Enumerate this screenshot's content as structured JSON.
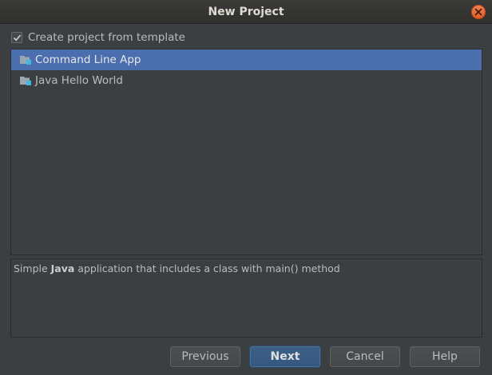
{
  "window": {
    "title": "New Project"
  },
  "template_option": {
    "checked": true,
    "label": "Create project from template"
  },
  "templates": {
    "items": [
      {
        "label": "Command Line App",
        "selected": true
      },
      {
        "label": "Java Hello World",
        "selected": false
      }
    ]
  },
  "description": {
    "prefix": "Simple ",
    "bold": "Java",
    "suffix": " application that includes a class with main() method"
  },
  "buttons": {
    "previous": "Previous",
    "next": "Next",
    "cancel": "Cancel",
    "help": "Help"
  },
  "colors": {
    "background": "#3c3f41",
    "selection": "#4b6eaf",
    "default_button": "#365880",
    "close_button": "#e25b1f"
  },
  "icons": {
    "close": "close-icon",
    "checkbox": "checkmark-icon",
    "template": "folder-icon"
  }
}
